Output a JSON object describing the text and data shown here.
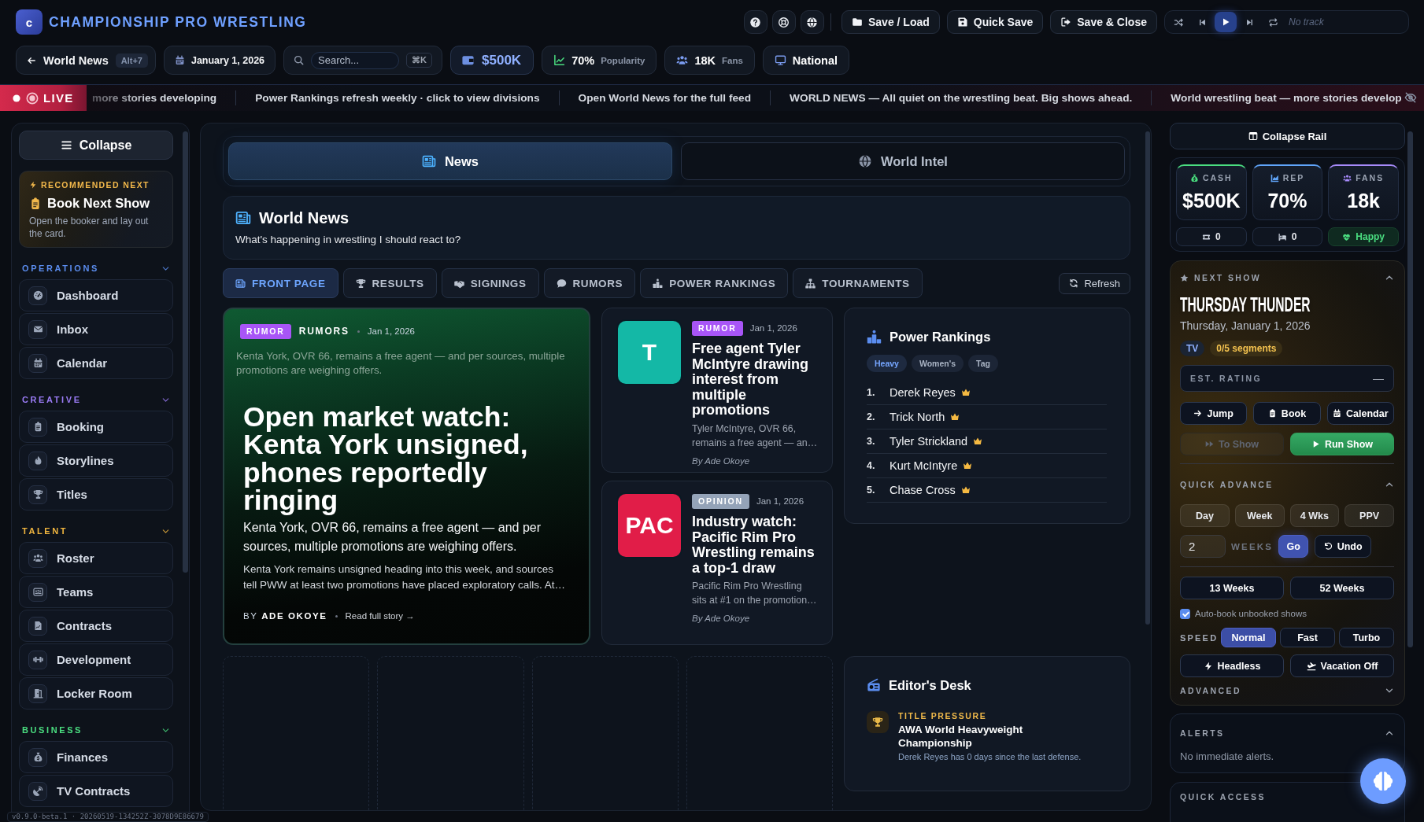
{
  "app": {
    "logo": "c",
    "title": "CHAMPIONSHIP PRO WRESTLING"
  },
  "toolbar_buttons": [
    {
      "label": "Save / Load"
    },
    {
      "label": "Quick Save"
    },
    {
      "label": "Save & Close"
    }
  ],
  "player": {
    "track": "No track"
  },
  "back_link": {
    "label": "World News",
    "shortcut": "Alt+7"
  },
  "game_date": "January 1, 2026",
  "search": {
    "placeholder": "Search...",
    "shortcut": "⌘K"
  },
  "status_chips": [
    {
      "kind": "cash",
      "value": "$500K"
    },
    {
      "kind": "popularity",
      "value": "70%",
      "label": "Popularity"
    },
    {
      "kind": "fans",
      "value": "18K",
      "label": "Fans"
    },
    {
      "kind": "reach",
      "value": "National"
    }
  ],
  "ticker": {
    "label": "LIVE",
    "items": [
      "more stories developing",
      "Power Rankings refresh weekly · click to view divisions",
      "Open World News for the full feed",
      "WORLD NEWS — All quiet on the wrestling beat. Big shows ahead.",
      "World wrestling beat — more stories develop"
    ]
  },
  "sidebar": {
    "collapse_label": "Collapse",
    "recommended": {
      "eyebrow": "RECOMMENDED NEXT",
      "title": "Book Next Show",
      "description": "Open the booker and lay out the card."
    },
    "sections": [
      {
        "title": "OPERATIONS",
        "color": "#5b8def",
        "expanded": true,
        "items": [
          {
            "label": "Dashboard"
          },
          {
            "label": "Inbox"
          },
          {
            "label": "Calendar"
          }
        ]
      },
      {
        "title": "CREATIVE",
        "color": "#9b7cf6",
        "expanded": true,
        "items": [
          {
            "label": "Booking"
          },
          {
            "label": "Storylines"
          },
          {
            "label": "Titles"
          }
        ]
      },
      {
        "title": "TALENT",
        "color": "#f0b53f",
        "expanded": true,
        "items": [
          {
            "label": "Roster"
          },
          {
            "label": "Teams"
          },
          {
            "label": "Contracts"
          },
          {
            "label": "Development"
          },
          {
            "label": "Locker Room"
          }
        ]
      },
      {
        "title": "BUSINESS",
        "color": "#4ade80",
        "expanded": true,
        "items": [
          {
            "label": "Finances"
          },
          {
            "label": "TV Contracts"
          }
        ]
      }
    ]
  },
  "version": "v0.9.0-beta.1 · 20260519-134252Z-3078D9E86679",
  "view_tabs": [
    {
      "label": "News",
      "selected": true
    },
    {
      "label": "World Intel",
      "selected": false
    }
  ],
  "page_header": {
    "title": "World News",
    "subtitle": "What's happening in wrestling I should react to?"
  },
  "filter_tabs": [
    {
      "label": "FRONT PAGE",
      "selected": true
    },
    {
      "label": "RESULTS",
      "selected": false
    },
    {
      "label": "SIGNINGS",
      "selected": false
    },
    {
      "label": "RUMORS",
      "selected": false
    },
    {
      "label": "POWER RANKINGS",
      "selected": false
    },
    {
      "label": "TOURNAMENTS",
      "selected": false
    }
  ],
  "refresh_label": "Refresh",
  "lead_story": {
    "kind": "rumor",
    "tag": "RUMOR",
    "category": "RUMORS",
    "date": "Jan 1, 2026",
    "summary": "Kenta York, OVR 66, remains a free agent — and per sources, multiple promotions are weighing offers.",
    "headline": "Open market watch: Kenta York unsigned, phones reportedly ringing",
    "dek": "Kenta York, OVR 66, remains a free agent — and per sources, multiple promotions are weighing offers.",
    "body": "Kenta York remains unsigned heading into this week, and sources tell PWW at least two promotions have placed exploratory calls. At…",
    "byline": "BY **ADE OKOYE**",
    "link": "Read full story →"
  },
  "stories": [
    {
      "avatar": "T",
      "color": "#14b8a6",
      "kind": "rumor",
      "tag": "RUMOR",
      "date": "Jan 1, 2026",
      "headline": "Free agent Tyler McIntyre drawing interest from multiple promotions",
      "summary": "Tyler McIntyre, OVR 66, remains a free agent — an…",
      "byline": "By Ade Okoye"
    },
    {
      "avatar": "PAC",
      "color": "#e11d48",
      "kind": "opinion",
      "tag": "OPINION",
      "date": "Jan 1, 2026",
      "headline": "Industry watch: Pacific Rim Pro Wrestling remains a top-1 draw",
      "summary": "Pacific Rim Pro Wrestling sits at #1 on the promotion…",
      "byline": "By Ade Okoye"
    }
  ],
  "power_rankings": {
    "title": "Power Rankings",
    "divisions": [
      {
        "label": "Heavy",
        "selected": true
      },
      {
        "label": "Women's",
        "selected": false
      },
      {
        "label": "Tag",
        "selected": false
      }
    ],
    "rows": [
      {
        "rank": "1.",
        "name": "Derek Reyes"
      },
      {
        "rank": "2.",
        "name": "Trick North"
      },
      {
        "rank": "3.",
        "name": "Tyler Strickland"
      },
      {
        "rank": "4.",
        "name": "Kurt McIntyre"
      },
      {
        "rank": "5.",
        "name": "Chase Cross"
      }
    ]
  },
  "editors_desk": {
    "title": "Editor's Desk",
    "items": [
      {
        "eyebrow": "TITLE PRESSURE",
        "title": "AWA World Heavyweight Championship",
        "detail": "Derek Reyes has 0 days since the last defense."
      }
    ]
  },
  "rail": {
    "collapse_label": "Collapse Rail",
    "stats": [
      {
        "label": "CASH",
        "value": "$500K",
        "color": "#4ade80"
      },
      {
        "label": "REP",
        "value": "70%",
        "color": "#60a5fa"
      },
      {
        "label": "FANS",
        "value": "18k",
        "color": "#a78bfa"
      }
    ],
    "mini_stats": [
      {
        "kind": "count",
        "value": "0"
      },
      {
        "kind": "count",
        "value": "0"
      },
      {
        "kind": "mood",
        "value": "Happy"
      }
    ],
    "next_show": {
      "heading": "NEXT SHOW",
      "expanded": true,
      "name": "THURSDAY THUNDER",
      "date": "Thursday, January 1, 2026",
      "tags": [
        {
          "kind": "broadcast",
          "label": "TV"
        },
        {
          "kind": "segments",
          "label": "0/5 segments"
        }
      ],
      "rating_label": "EST. RATING",
      "rating_value": "—",
      "actions": [
        {
          "label": "Jump"
        },
        {
          "label": "Book"
        },
        {
          "label": "Calendar"
        }
      ],
      "to_show": {
        "label": "To Show",
        "disabled": true
      },
      "run_show": {
        "label": "Run Show"
      }
    },
    "quick_advance": {
      "heading": "QUICK ADVANCE",
      "expanded": true,
      "steps": [
        {
          "label": "Day"
        },
        {
          "label": "Week"
        },
        {
          "label": "4 Wks"
        },
        {
          "label": "PPV"
        }
      ],
      "weeks_value": "2",
      "weeks_label": "WEEKS",
      "go_label": "Go",
      "undo_label": "Undo",
      "long_steps": [
        {
          "label": "13 Weeks"
        },
        {
          "label": "52 Weeks"
        }
      ],
      "auto_book": {
        "label": "Auto-book unbooked shows",
        "checked": true
      },
      "speed_label": "SPEED",
      "speeds": [
        {
          "label": "Normal",
          "selected": true
        },
        {
          "label": "Fast",
          "selected": false
        },
        {
          "label": "Turbo",
          "selected": false
        }
      ],
      "toggles": [
        {
          "label": "Headless"
        },
        {
          "label": "Vacation Off"
        }
      ],
      "advanced": {
        "label": "ADVANCED",
        "expanded": false
      }
    },
    "alerts": {
      "heading": "ALERTS",
      "expanded": true,
      "message": "No immediate alerts."
    },
    "quick_access": {
      "heading": "QUICK ACCESS"
    }
  }
}
